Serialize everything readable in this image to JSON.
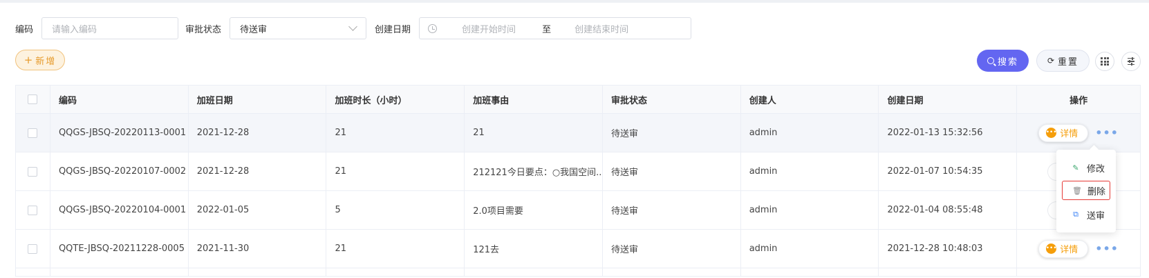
{
  "filters": {
    "code_label": "编码",
    "code_placeholder": "请输入编码",
    "status_label": "审批状态",
    "status_value": "待送审",
    "date_label": "创建日期",
    "date_start_placeholder": "创建开始时间",
    "date_separator": "至",
    "date_end_placeholder": "创建结束时间"
  },
  "toolbar": {
    "add_label": "新增",
    "search_label": "搜索",
    "reset_label": "重置"
  },
  "table": {
    "headers": [
      "编码",
      "加班日期",
      "加班时长（小时）",
      "加班事由",
      "审批状态",
      "创建人",
      "创建日期",
      "操作"
    ],
    "rows": [
      {
        "code": "QQGS-JBSQ-20220113-0001",
        "date": "2021-12-28",
        "hours": "21",
        "reason": "21",
        "status": "待送审",
        "creator": "admin",
        "created": "2022-01-13 15:32:56"
      },
      {
        "code": "QQGS-JBSQ-20220107-0002",
        "date": "2021-12-28",
        "hours": "21",
        "reason": "212121今日要点：○我国空间...",
        "status": "待送审",
        "creator": "admin",
        "created": "2022-01-07 10:54:35"
      },
      {
        "code": "QQGS-JBSQ-20220104-0001",
        "date": "2022-01-05",
        "hours": "5",
        "reason": "2.0项目需要",
        "status": "待送审",
        "creator": "admin",
        "created": "2022-01-04 08:55:48"
      },
      {
        "code": "QQTE-JBSQ-20211228-0005",
        "date": "2021-11-30",
        "hours": "21",
        "reason": "121去",
        "status": "待送审",
        "creator": "admin",
        "created": "2021-12-28 10:48:03"
      }
    ],
    "detail_label": "详情"
  },
  "menu": {
    "edit_label": "修改",
    "delete_label": "删除",
    "submit_label": "送审"
  },
  "colors": {
    "primary": "#6366f1",
    "warning": "#f59e0b",
    "danger_outline": "#e53935",
    "link_blue": "#7aa7e8"
  }
}
